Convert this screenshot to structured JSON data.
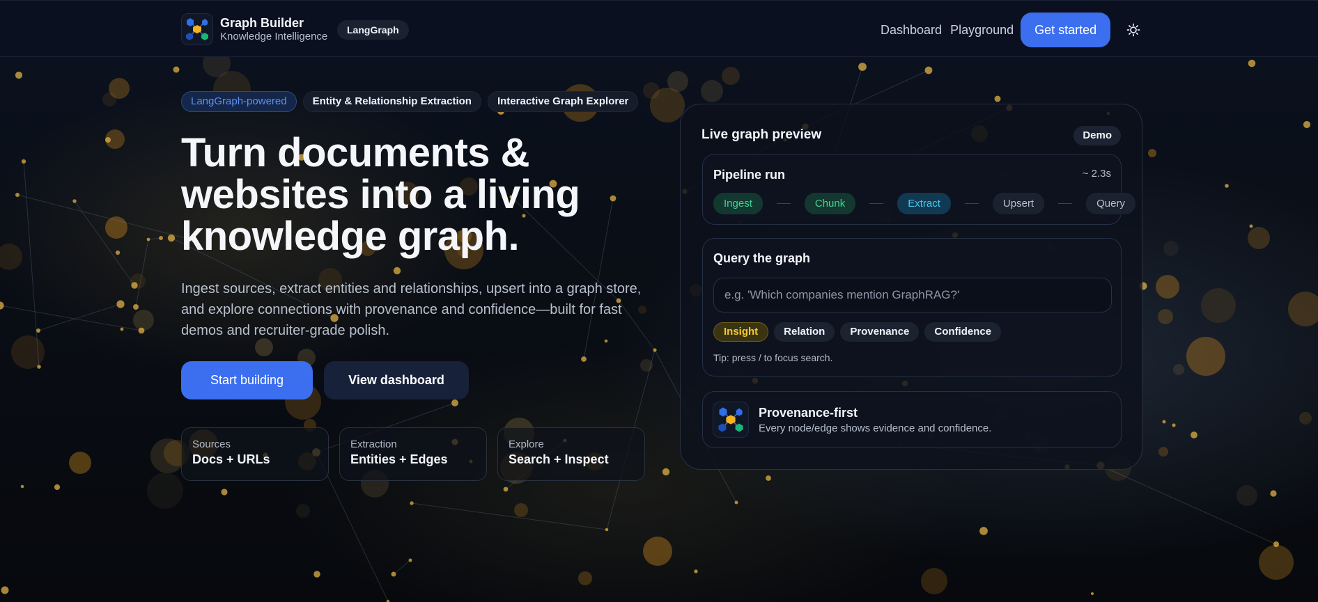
{
  "header": {
    "brand_title": "Graph Builder",
    "brand_subtitle": "Knowledge Intelligence",
    "badge": "LangGraph",
    "nav": [
      "Dashboard",
      "Playground"
    ],
    "cta": "Get started",
    "theme_icon": "sun-icon"
  },
  "hero": {
    "chips": [
      "LangGraph-powered",
      "Entity & Relationship Extraction",
      "Interactive Graph Explorer"
    ],
    "title_lines": [
      "Turn documents &",
      "websites into a living",
      "knowledge graph."
    ],
    "description_lines": [
      "Ingest sources, extract entities and relationships, upsert into a graph store,",
      "and explore connections with provenance and confidence—built for fast",
      "demos and recruiter-grade polish."
    ],
    "primary_button": "Start building",
    "secondary_button": "View dashboard",
    "stats": [
      {
        "label": "Sources",
        "value": "Docs + URLs"
      },
      {
        "label": "Extraction",
        "value": "Entities + Edges"
      },
      {
        "label": "Explore",
        "value": "Search + Inspect"
      }
    ]
  },
  "preview": {
    "title": "Live graph preview",
    "badge": "Demo",
    "pipeline": {
      "title": "Pipeline run",
      "time": "~ 2.3s",
      "steps": [
        {
          "label": "Ingest",
          "state": "done"
        },
        {
          "label": "Chunk",
          "state": "done"
        },
        {
          "label": "Extract",
          "state": "active"
        },
        {
          "label": "Upsert",
          "state": "pending"
        },
        {
          "label": "Query",
          "state": "pending"
        }
      ]
    },
    "query": {
      "title": "Query the graph",
      "placeholder": "e.g. 'Which companies mention GraphRAG?'",
      "tags": [
        "Insight",
        "Relation",
        "Provenance",
        "Confidence"
      ],
      "selected_tag": "Insight",
      "tip": "Tip: press / to focus search."
    },
    "provenance": {
      "title": "Provenance-first",
      "subtitle": "Every node/edge shows evidence and confidence."
    }
  },
  "colors": {
    "accent": "#3b6ff0",
    "done": "#42d39a",
    "active": "#48c8ef",
    "insight": "#f2c933"
  }
}
